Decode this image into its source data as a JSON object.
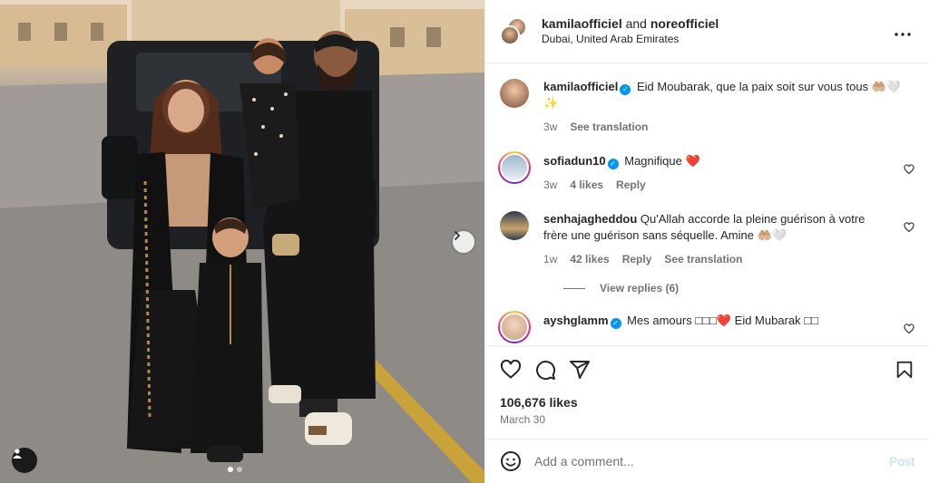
{
  "post": {
    "header": {
      "author": "kamilaofficiel",
      "and_text": "and",
      "collaborator": "noreofficiel",
      "location": "Dubai, United Arab Emirates"
    },
    "caption": {
      "user": "kamilaofficiel",
      "text": "Eid Moubarak, que la paix soit sur vous tous 🤲🏼🤍 ✨",
      "time": "3w",
      "translation": "See translation"
    },
    "comments": [
      {
        "user": "sofiadun10",
        "text": "Magnifique ❤️",
        "time": "3w",
        "likes": "4 likes",
        "reply": "Reply"
      },
      {
        "user": "senhajagheddou",
        "text": "Qu'Allah accorde la pleine guérison à votre frère une guérison sans séquelle. Amine 🤲🏼🤍",
        "time": "1w",
        "likes": "42 likes",
        "reply": "Reply",
        "translation": "See translation",
        "view_replies": "View replies (6)"
      },
      {
        "user": "ayshglamm",
        "text": "Mes amours □□□❤️ Eid Mubarak □□"
      }
    ],
    "likes": "106,676 likes",
    "date": "March 30",
    "add_comment": {
      "placeholder": "Add a comment...",
      "post_label": "Post"
    },
    "carousel": {
      "slide_count": 2,
      "current_slide": 1
    }
  },
  "colors": {
    "verified": "#0095f6",
    "post_disabled": "#b2dffc",
    "secondary_text": "#737373",
    "border": "#efefef"
  },
  "icons": {
    "header_more": "more-horizontal-icon",
    "like": "heart-icon",
    "comment": "comment-icon",
    "share": "share-icon",
    "save": "bookmark-icon",
    "emoji": "emoji-icon",
    "next": "chevron-right-icon",
    "tag": "user-tag-icon"
  }
}
